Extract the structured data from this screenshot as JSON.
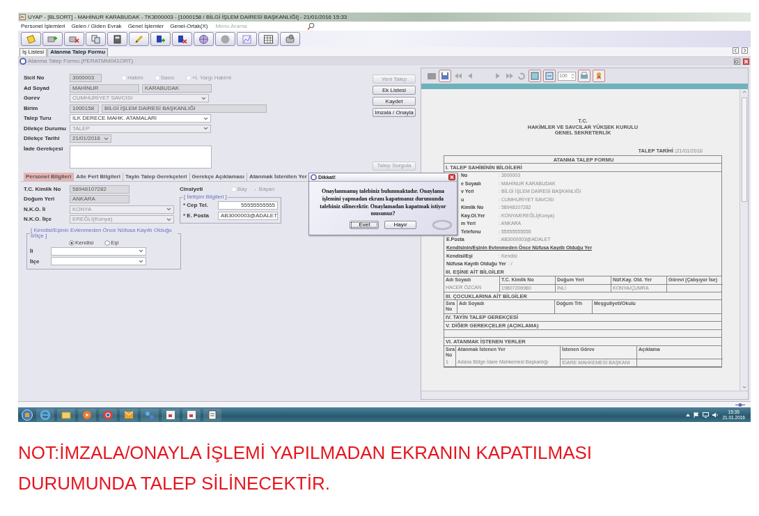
{
  "window": {
    "title": "UYAP - [BLSORT] -  MAHİNUR KARABUDAK - TK3000003 - [1000158 / BİLGİ İŞLEM DAİRESİ BAŞKANLIĞI] - 21/01/2016 15:33"
  },
  "menu": [
    {
      "label": "Personel İşlemleri"
    },
    {
      "label": "Gelen / Giden Evrak"
    },
    {
      "label": "Genel İşlemler"
    },
    {
      "label": "Genel-Ortak(X)"
    }
  ],
  "menu_search": {
    "placeholder": "Menu Arama"
  },
  "tabs": [
    {
      "label": "İş Listesi",
      "selected": false
    },
    {
      "label": "Atanma Talep Formu",
      "selected": true
    }
  ],
  "form_title": "Atanma Talep Formu (PERATMM041ORT)",
  "form": {
    "rows": [
      {
        "label": "Sicil No",
        "fields": [
          {
            "kind": "text",
            "value": "3000003",
            "readonly": true,
            "disabled": false
          }
        ],
        "options": {
          "disabled": true,
          "items": [
            {
              "label": "Hakim",
              "selected": false
            },
            {
              "label": "Savcı",
              "selected": false
            },
            {
              "label": "+İ. Yargı Hakimi",
              "selected": false
            }
          ]
        }
      },
      {
        "label": "Ad Soyad",
        "fields": [
          {
            "kind": "text",
            "value": "MAHİNUR",
            "readonly": true,
            "disabled": false
          },
          {
            "kind": "text",
            "value": "KARABUDAK",
            "readonly": true,
            "disabled": false
          }
        ]
      },
      {
        "label": "Gorev",
        "fields": [
          {
            "kind": "select",
            "value": "CUMHURİYET SAVCISI",
            "readonly": false,
            "disabled": true
          }
        ]
      },
      {
        "label": "Birim",
        "fields": [
          {
            "kind": "text",
            "value": "1000158",
            "readonly": true,
            "disabled": false
          },
          {
            "kind": "text",
            "value": "BİLGİ İŞLEM DAİRESİ BAŞKANLIĞI",
            "readonly": true,
            "disabled": false
          }
        ]
      },
      {
        "label": "Talep Turu",
        "fields": [
          {
            "kind": "select",
            "value": "İLK DERECE MAHK. ATAMALARI",
            "readonly": false,
            "disabled": false
          }
        ]
      },
      {
        "label": "Dilekçe Durumu",
        "fields": [
          {
            "kind": "select",
            "value": "TALEP",
            "readonly": false,
            "disabled": true
          }
        ]
      },
      {
        "label": "Dilekçe Tarihi",
        "fields": [
          {
            "kind": "date",
            "value": "21/01/2016",
            "readonly": true,
            "disabled": false
          }
        ]
      },
      {
        "label": "İade Gerekçesi",
        "fields": [
          {
            "kind": "area",
            "readonly": false,
            "disabled": false
          }
        ]
      }
    ],
    "actions": [
      {
        "label": "Yeni Talep",
        "disabled": true
      },
      {
        "label": "Ek Listesi",
        "disabled": false
      },
      {
        "label": "Kaydet",
        "disabled": false
      },
      {
        "label": "İmzala / Onayla",
        "disabled": false
      },
      {
        "label": "Talep Sorgula",
        "disabled": true
      }
    ]
  },
  "subtabs": [
    {
      "label": "Personel Bilgileri",
      "selected": true
    },
    {
      "label": "Aile Fert Bilgileri",
      "selected": false
    },
    {
      "label": "Tayin Talep Gerekçeleri",
      "selected": false
    },
    {
      "label": "Gerekçe Açıklaması",
      "selected": false
    },
    {
      "label": "Atanmak İstenilen Yer",
      "selected": false
    }
  ],
  "personel": {
    "rows": [
      {
        "label": "T.C. Kimlik No",
        "field": {
          "kind": "text",
          "value": "58948107282",
          "readonly": true,
          "disabled": false
        }
      },
      {
        "label": "Doğum Yeri",
        "field": {
          "kind": "text",
          "value": "ANKARA",
          "readonly": true,
          "disabled": false
        }
      },
      {
        "label": "N.K.O. İl",
        "field": {
          "kind": "select",
          "value": "KONYA",
          "readonly": false,
          "disabled": true
        }
      },
      {
        "label": "N.K.O. İlçe",
        "field": {
          "kind": "select",
          "value": "EREĞLİ(Konya)",
          "readonly": false,
          "disabled": true
        }
      }
    ],
    "gender": {
      "label": "Cinsiyeti",
      "disabled": true,
      "items": [
        {
          "label": "Bay",
          "selected": false
        },
        {
          "label": "Bayan",
          "selected": true
        }
      ]
    },
    "contact": {
      "legend": "[ İletişim Bilgileri ]",
      "rows": [
        {
          "label": "* Cep Tel.",
          "field": {
            "kind": "text",
            "value": "55555555555",
            "readonly": false,
            "disabled": false
          }
        },
        {
          "label": "* E. Posta",
          "field": {
            "kind": "text",
            "value": "AB3000003@ADALET",
            "readonly": false,
            "disabled": false
          }
        }
      ]
    },
    "origin": {
      "legend": "[ Kendisi/Eşinin Evlenmeden Önce Nüfusa Kayıtlı Olduğu İl/İlçe ]",
      "items": [
        {
          "label": "Kendisi",
          "selected": true
        },
        {
          "label": "Eşi",
          "selected": false
        }
      ],
      "rows": [
        {
          "label": "İl",
          "field": {
            "kind": "select",
            "readonly": false,
            "disabled": false
          }
        },
        {
          "label": "İlçe",
          "field": {
            "kind": "select",
            "readonly": false,
            "disabled": false
          }
        }
      ]
    }
  },
  "dialog": {
    "title": "Dikkat!",
    "message": "Onaylanmamış talebiniz bulunmaktadır. Onaylama işlemini yapmadan ekranı kapatmanız durumunda talebiniz silinecektir. Onaylamadan kapatmak istiyor musunuz?",
    "buttons": [
      {
        "label": "Evet",
        "selected": true
      },
      {
        "label": "Hayır",
        "selected": false
      }
    ]
  },
  "viewer": {
    "zoom": "100",
    "report": {
      "header": [
        "T.C.",
        "HAKİMLER VE SAVCILAR YÜKSEK KURULU",
        "GENEL SEKRETERLİK"
      ],
      "date_label": "TALEP TARİHİ :",
      "date_value": "21/01/2016",
      "title": "ATANMA TALEP FORMU",
      "sections": [
        {
          "kind": "heading",
          "text": "I. TALEP SAHİBİNİN BİLGİLERİ"
        },
        {
          "kind": "field",
          "label": "No",
          "value": ": 3000003"
        },
        {
          "kind": "field",
          "label": "e Soyadı",
          "value": ": MAHİNUR KARABUDAK"
        },
        {
          "kind": "field",
          "label": "v Yeri",
          "value": ": BİLGİ İŞLEM DAİRESİ BAŞKANLIĞI"
        },
        {
          "kind": "field",
          "label": "u",
          "value": ": CUMHURİYET SAVCISI"
        },
        {
          "kind": "field",
          "label": "Kimlik No",
          "value": ": 58948107282"
        },
        {
          "kind": "field",
          "label": "Kay.Ol.Yer",
          "value": ": KONYA/EREĞLİ(Konya)"
        },
        {
          "kind": "field",
          "label": "m Yeri",
          "value": ": ANKARA"
        },
        {
          "kind": "field",
          "label": "Telefonu",
          "value": ": 55555555555"
        },
        {
          "kind": "field",
          "label": "E.Posta",
          "value": ": AB3000003@ADALET"
        },
        {
          "kind": "note",
          "text": "Kendisinin/Eşinin Evlenmeden Önce Nüfusa Kayıtlı Olduğu Yer"
        },
        {
          "kind": "field",
          "label": "Kendisi/Eşi",
          "value": ": Kendisi"
        },
        {
          "kind": "field",
          "label": "Nüfusa Kayıtlı Olduğu Yer",
          "value": ": /"
        },
        {
          "kind": "heading",
          "text": "III. EŞİNE AİT BİLGİLER"
        },
        {
          "kind": "table",
          "columns": [
            "Adı Soyadı",
            "T.C. Kimlik No",
            "Doğum Yeri",
            "Nüf.Kay. Old. Yer",
            "Görevi (Çalışıyor İse)"
          ],
          "rows": [
            [
              "HACER ÖZCAN",
              "19807206980",
              "İNLİ",
              "KONYA/ÇUMRA"
            ]
          ]
        },
        {
          "kind": "heading",
          "text": "III. ÇOCUKLARINA AİT BİLGİLER"
        },
        {
          "kind": "table",
          "columns": [
            "Sıra No",
            "Adı Soyadı",
            "Doğum Trh",
            "Meşguliyeti/Okulu"
          ]
        },
        {
          "kind": "heading",
          "text": "IV. TAYİN TALEP GEREKÇESİ"
        },
        {
          "kind": "heading",
          "text": "V. DİĞER GEREKÇELER (AÇIKLAMA)"
        },
        {
          "kind": "blank"
        },
        {
          "kind": "heading",
          "text": "VI. ATANMAK İSTENEN YERLER"
        },
        {
          "kind": "table",
          "columns": [
            "Sıra No",
            "Atanmak İstenen Yer",
            "İstenen Görev",
            "Açıklama"
          ],
          "rows": [
            [
              "1",
              "Adana Bölge İdare Mahkemesi Başkanlığı",
              "İDARE MAHKEMESİ BAŞKANI"
            ]
          ]
        }
      ]
    }
  },
  "taskbar": {
    "time": "15:35",
    "date": "21.01.2016"
  },
  "note": "NOT:İMZALA/ONAYLA İŞLEMİ YAPILMADAN EKRANIN KAPATILMASI DURUMUNDA TALEP SİLİNECEKTİR."
}
